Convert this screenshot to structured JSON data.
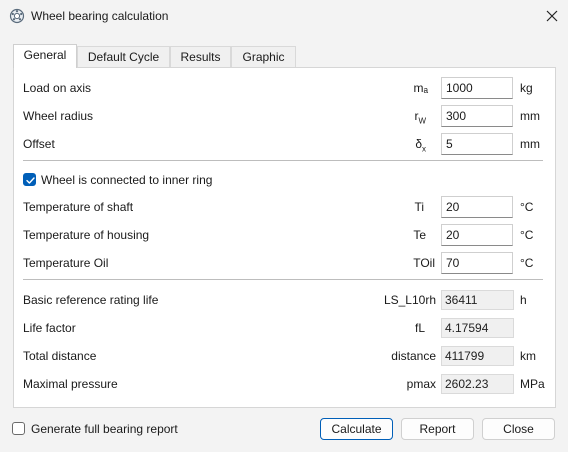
{
  "window": {
    "title": "Wheel bearing calculation",
    "icon": "bearing-app-icon",
    "close_icon": "close-icon"
  },
  "tabs": [
    {
      "label": "General",
      "active": true
    },
    {
      "label": "Default Cycle",
      "active": false
    },
    {
      "label": "Results",
      "active": false
    },
    {
      "label": "Graphic",
      "active": false
    }
  ],
  "inputs": {
    "load": {
      "label": "Load on axis",
      "symbol": "mₐ",
      "value": "1000",
      "unit": "kg"
    },
    "radius": {
      "label": "Wheel radius",
      "symbol_main": "r",
      "symbol_sub": "W",
      "value": "300",
      "unit": "mm"
    },
    "offset": {
      "label": "Offset",
      "symbol_main": "δ",
      "symbol_sub": "x",
      "value": "5",
      "unit": "mm"
    }
  },
  "inner_ring": {
    "label": "Wheel is connected to inner ring",
    "checked": true
  },
  "temperatures": {
    "shaft": {
      "label": "Temperature of shaft",
      "symbol": "Ti",
      "value": "20",
      "unit": "°C"
    },
    "housing": {
      "label": "Temperature of housing",
      "symbol": "Te",
      "value": "20",
      "unit": "°C"
    },
    "oil": {
      "label": "Temperature Oil",
      "symbol": "TOil",
      "value": "70",
      "unit": "°C"
    }
  },
  "results": {
    "rating_life": {
      "label": "Basic reference rating life",
      "symbol": "LS_L10rh",
      "value": "36411",
      "unit": "h"
    },
    "life_factor": {
      "label": "Life factor",
      "symbol": "fL",
      "value": "4.17594",
      "unit": ""
    },
    "distance": {
      "label": "Total distance",
      "symbol": "distance",
      "value": "411799",
      "unit": "km"
    },
    "pressure": {
      "label": "Maximal pressure",
      "symbol": "pmax",
      "value": "2602.23",
      "unit": "MPa"
    }
  },
  "footer": {
    "report_checkbox": {
      "label": "Generate full bearing report",
      "checked": false
    },
    "calculate_label": "Calculate",
    "report_label": "Report",
    "close_label": "Close"
  },
  "colors": {
    "accent": "#005fb8",
    "panel": "#ffffff",
    "window": "#f3f3f3"
  }
}
